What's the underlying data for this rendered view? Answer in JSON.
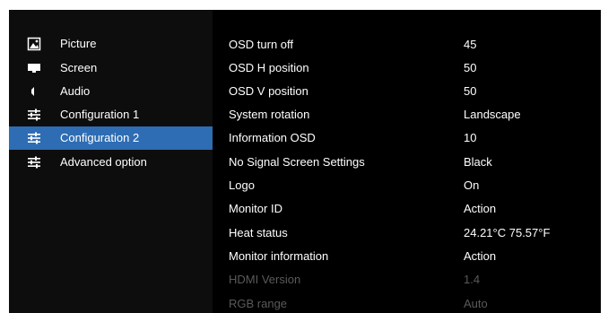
{
  "colors": {
    "background": "#000000",
    "sidebar": "#0d0d0d",
    "selected": "#2e6db3",
    "text": "#ffffff",
    "disabled_text": "#5a5a5a"
  },
  "sidebar": {
    "items": [
      {
        "label": "Picture",
        "icon": "picture-icon",
        "selected": false
      },
      {
        "label": "Screen",
        "icon": "screen-icon",
        "selected": false
      },
      {
        "label": "Audio",
        "icon": "speaker-icon",
        "selected": false
      },
      {
        "label": "Configuration 1",
        "icon": "sliders-icon",
        "selected": false
      },
      {
        "label": "Configuration 2",
        "icon": "sliders-icon",
        "selected": true
      },
      {
        "label": "Advanced option",
        "icon": "sliders-icon",
        "selected": false
      }
    ]
  },
  "settings": {
    "rows": [
      {
        "label": "OSD turn off",
        "value": "45",
        "enabled": true
      },
      {
        "label": "OSD H position",
        "value": "50",
        "enabled": true
      },
      {
        "label": "OSD V position",
        "value": "50",
        "enabled": true
      },
      {
        "label": "System rotation",
        "value": "Landscape",
        "enabled": true
      },
      {
        "label": "Information OSD",
        "value": "10",
        "enabled": true
      },
      {
        "label": "No Signal Screen Settings",
        "value": "Black",
        "enabled": true
      },
      {
        "label": "Logo",
        "value": "On",
        "enabled": true
      },
      {
        "label": "Monitor ID",
        "value": "Action",
        "enabled": true
      },
      {
        "label": "Heat status",
        "value": "24.21°C 75.57°F",
        "enabled": true
      },
      {
        "label": "Monitor information",
        "value": "Action",
        "enabled": true
      },
      {
        "label": "HDMI Version",
        "value": "1.4",
        "enabled": false
      },
      {
        "label": "RGB range",
        "value": "Auto",
        "enabled": false
      }
    ]
  }
}
